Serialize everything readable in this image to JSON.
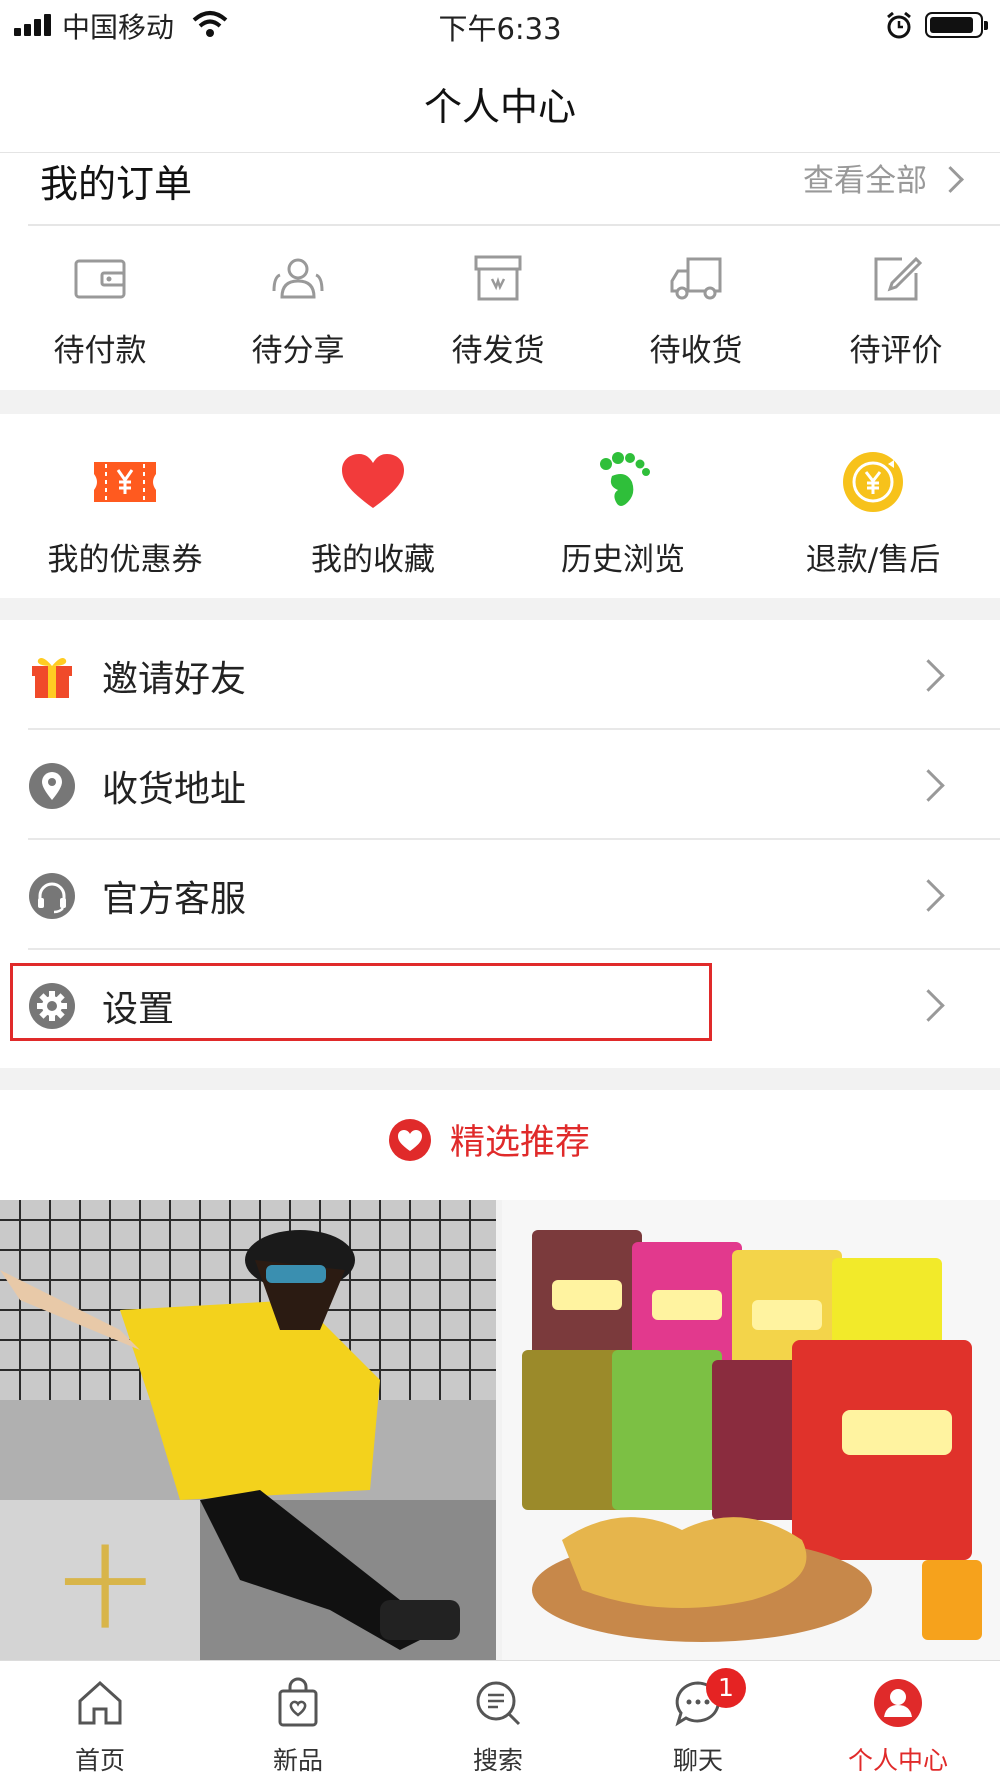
{
  "status_bar": {
    "carrier": "中国移动",
    "time": "下午6:33"
  },
  "header": {
    "title": "个人中心"
  },
  "orders": {
    "title": "我的订单",
    "view_all": "查看全部",
    "items": [
      {
        "label": "待付款",
        "icon": "wallet-icon"
      },
      {
        "label": "待分享",
        "icon": "users-icon"
      },
      {
        "label": "待发货",
        "icon": "package-icon"
      },
      {
        "label": "待收货",
        "icon": "truck-icon"
      },
      {
        "label": "待评价",
        "icon": "edit-icon"
      }
    ]
  },
  "tools": {
    "items": [
      {
        "label": "我的优惠券",
        "icon": "coupon-icon",
        "color": "#ff5a1f"
      },
      {
        "label": "我的收藏",
        "icon": "heart-icon",
        "color": "#f23b3b"
      },
      {
        "label": "历史浏览",
        "icon": "footprint-icon",
        "color": "#2fbf3a"
      },
      {
        "label": "退款/售后",
        "icon": "refund-icon",
        "color": "#f7c21b"
      }
    ]
  },
  "menu": {
    "items": [
      {
        "label": "邀请好友",
        "icon": "gift-icon"
      },
      {
        "label": "收货地址",
        "icon": "location-icon"
      },
      {
        "label": "官方客服",
        "icon": "headset-icon"
      },
      {
        "label": "设置",
        "icon": "settings-icon"
      }
    ]
  },
  "recommend": {
    "title": "精选推荐"
  },
  "products": [
    {
      "name": "girl-fashion-photo"
    },
    {
      "name": "noodle-snack-photo"
    }
  ],
  "tabbar": {
    "items": [
      {
        "label": "首页",
        "icon": "home-icon"
      },
      {
        "label": "新品",
        "icon": "bag-icon"
      },
      {
        "label": "搜索",
        "icon": "search-icon"
      },
      {
        "label": "聊天",
        "icon": "chat-icon",
        "badge": "1"
      },
      {
        "label": "个人中心",
        "icon": "profile-icon",
        "active": true
      }
    ]
  },
  "colors": {
    "accent": "#e02a2a",
    "badge": "#e52323"
  }
}
